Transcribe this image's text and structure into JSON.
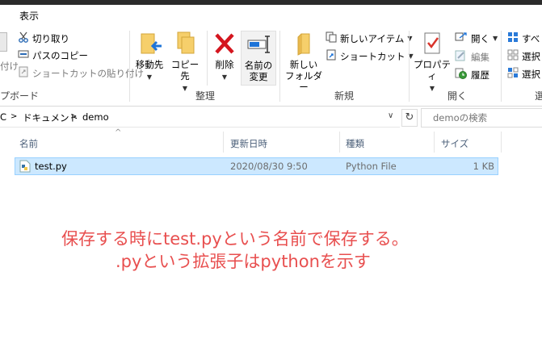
{
  "tabs": {
    "view": "表示"
  },
  "ribbon": {
    "clipboard": {
      "paste_partial": "付け",
      "cut": "切り取り",
      "copy_path": "パスのコピー",
      "paste_shortcut": "ショートカットの貼り付け",
      "label": "プボード"
    },
    "organize": {
      "move_to": "移動先",
      "copy_to": "コピー先",
      "delete": "削除",
      "rename_line1": "名前の",
      "rename_line2": "変更",
      "label": "整理"
    },
    "new": {
      "new_folder_line1": "新しい",
      "new_folder_line2": "フォルダー",
      "new_item": "新しいアイテム",
      "shortcut": "ショートカット",
      "label": "新規"
    },
    "open": {
      "properties": "プロパティ",
      "open": "開く",
      "edit": "編集",
      "history": "履歴",
      "label": "開く"
    },
    "select": {
      "select_all": "すべ",
      "select_none": "選択",
      "invert": "選択",
      "label_partial": "選"
    }
  },
  "address": {
    "crumbs": [
      "C",
      "ドキュメント",
      "demo"
    ]
  },
  "search": {
    "placeholder": "demoの検索"
  },
  "columns": {
    "name": "名前",
    "modified": "更新日時",
    "type": "種類",
    "size": "サイズ"
  },
  "files": [
    {
      "name": "test.py",
      "modified": "2020/08/30 9:50",
      "type": "Python File",
      "size": "1 KB"
    }
  ],
  "annotation": {
    "line1": "保存する時にtest.pyという名前で保存する。",
    "line2": ".pyという拡張子はpythonを示す"
  },
  "colors": {
    "annotation": "#e84f4f",
    "selection": "#cce8ff"
  }
}
